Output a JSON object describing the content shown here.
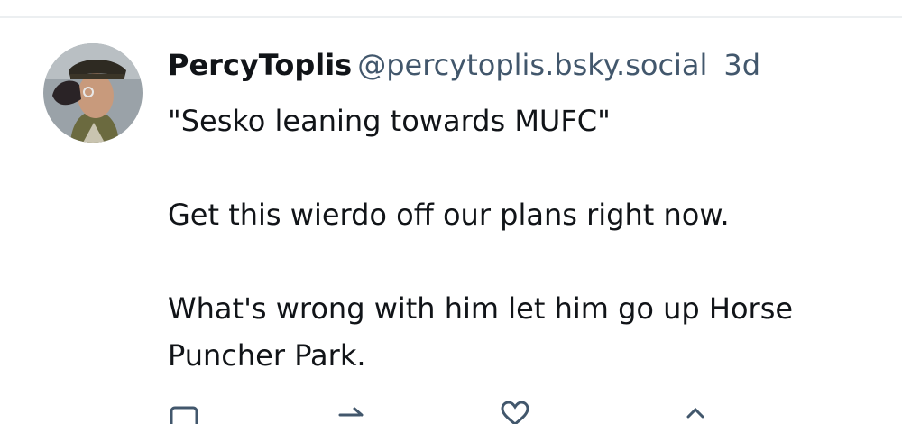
{
  "post": {
    "author": {
      "display_name": "PercyToplis",
      "handle": "@percytoplis.bsky.social"
    },
    "timestamp": "3d",
    "lines": [
      "\"Sesko leaning towards MUFC\"",
      "Get this wierdo off our plans right now.",
      "What's wrong with him let him go up Horse Puncher Park."
    ],
    "actions": [
      {
        "icon": "reply-icon"
      },
      {
        "icon": "repost-icon"
      },
      {
        "icon": "like-icon"
      },
      {
        "icon": "more-icon"
      }
    ]
  },
  "colors": {
    "text": "#111418",
    "muted": "#42576c",
    "divider": "#eceff1"
  }
}
